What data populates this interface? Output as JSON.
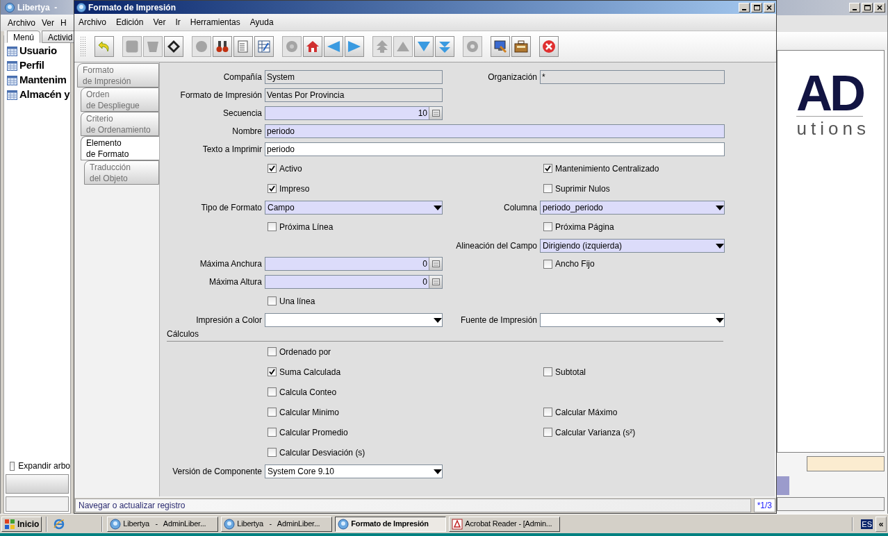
{
  "left_window": {
    "title": "Libertya  -",
    "menu": [
      "Archivo",
      "Ver",
      "H"
    ],
    "tabs": [
      {
        "label": "Menú",
        "selected": true
      },
      {
        "label": "Activid",
        "selected": false
      }
    ],
    "tree": [
      "Usuario",
      "Perfil",
      "Mantenim",
      "Almacén y"
    ],
    "expand_checkbox": {
      "label": "Expandir arbo",
      "checked": false
    }
  },
  "main_window": {
    "title": "Formato de Impresión",
    "menu": [
      "Archivo",
      "Edición",
      "Ver",
      "Ir",
      "Herramientas",
      "Ayuda"
    ],
    "toolbar": [
      [
        {
          "kind": "undo",
          "disabled": false
        }
      ],
      [
        {
          "kind": "new",
          "disabled": true
        },
        {
          "kind": "delete",
          "disabled": true
        },
        {
          "kind": "save",
          "disabled": false
        }
      ],
      [
        {
          "kind": "refresh",
          "disabled": true
        },
        {
          "kind": "find",
          "disabled": false
        },
        {
          "kind": "attachment",
          "disabled": false
        },
        {
          "kind": "grid",
          "disabled": false
        }
      ],
      [
        {
          "kind": "history",
          "disabled": true
        },
        {
          "kind": "home",
          "disabled": false
        },
        {
          "kind": "previous",
          "disabled": false
        },
        {
          "kind": "next",
          "disabled": false
        }
      ],
      [
        {
          "kind": "first",
          "disabled": true
        },
        {
          "kind": "up",
          "disabled": true
        },
        {
          "kind": "down",
          "disabled": false
        },
        {
          "kind": "last",
          "disabled": false
        }
      ],
      [
        {
          "kind": "report",
          "disabled": true
        }
      ],
      [
        {
          "kind": "preview",
          "disabled": false
        },
        {
          "kind": "archive",
          "disabled": false
        }
      ],
      [
        {
          "kind": "close",
          "disabled": false
        }
      ]
    ],
    "tabs": [
      {
        "label": "Formato\nde Impresión",
        "selected": false
      },
      {
        "label": "Orden\nde Despliegue",
        "selected": false
      },
      {
        "label": "Criterio\nde Ordenamiento",
        "selected": false
      },
      {
        "label": "Elemento\nde Formato",
        "selected": true
      },
      {
        "label": "Traducción\ndel Objeto",
        "selected": false
      }
    ],
    "rows": [
      {
        "left": {
          "kind": "text",
          "label": "Compañía",
          "value": "System",
          "readonly": true
        },
        "right": {
          "kind": "text",
          "label": "Organización",
          "value": "*",
          "readonly": true
        }
      },
      {
        "left": {
          "kind": "text",
          "label": "Formato de Impresión",
          "value": "Ventas Por Provincia",
          "readonly": true
        }
      },
      {
        "left": {
          "kind": "number",
          "label": "Secuencia",
          "value": "10",
          "readonly": false,
          "required": true
        }
      },
      {
        "full": {
          "kind": "text",
          "label": "Nombre",
          "value": "periodo",
          "readonly": false,
          "required": true
        }
      },
      {
        "full": {
          "kind": "text",
          "label": "Texto a Imprimir",
          "value": "periodo",
          "readonly": false,
          "required": false
        }
      },
      {
        "left": {
          "kind": "checkbox",
          "label": "Activo",
          "checked": true
        },
        "right": {
          "kind": "checkbox",
          "label": "Mantenimiento Centralizado",
          "checked": true
        }
      },
      {
        "left": {
          "kind": "checkbox",
          "label": "Impreso",
          "checked": true
        },
        "right": {
          "kind": "checkbox",
          "label": "Suprimir Nulos",
          "checked": false
        }
      },
      {
        "left": {
          "kind": "combo",
          "label": "Tipo de Formato",
          "value": "Campo",
          "readonly": false,
          "required": true
        },
        "right": {
          "kind": "combo",
          "label": "Columna",
          "value": "periodo_periodo",
          "readonly": false,
          "required": true
        }
      },
      {
        "left": {
          "kind": "checkbox",
          "label": "Próxima Línea",
          "checked": false
        },
        "right": {
          "kind": "checkbox",
          "label": "Próxima Página",
          "checked": false
        }
      },
      {
        "right": {
          "kind": "combo",
          "label": "Alineación del Campo",
          "value": "Dirigiendo (izquierda)",
          "readonly": false,
          "required": true
        }
      },
      {
        "left": {
          "kind": "number",
          "label": "Máxima Anchura",
          "value": "0",
          "readonly": false,
          "required": true
        },
        "right": {
          "kind": "checkbox",
          "label": "Ancho Fijo",
          "checked": false
        }
      },
      {
        "left": {
          "kind": "number",
          "label": "Máxima Altura",
          "value": "0",
          "readonly": false,
          "required": true
        }
      },
      {
        "left": {
          "kind": "checkbox",
          "label": "Una línea",
          "checked": false
        }
      },
      {
        "left": {
          "kind": "combo",
          "label": "Impresión a Color",
          "readonly": false,
          "required": false
        },
        "right": {
          "kind": "combo",
          "label": "Fuente de Impresión",
          "readonly": false,
          "required": false
        }
      },
      {
        "section": "Cálculos"
      },
      {
        "left": {
          "kind": "checkbox",
          "label": "Ordenado por",
          "checked": false
        }
      },
      {
        "left": {
          "kind": "checkbox",
          "label": "Suma Calculada",
          "checked": true
        },
        "right": {
          "kind": "checkbox",
          "label": "Subtotal",
          "checked": false
        }
      },
      {
        "left": {
          "kind": "checkbox",
          "label": "Calcula Conteo",
          "checked": false
        }
      },
      {
        "left": {
          "kind": "checkbox",
          "label": "Calcular Minimo",
          "checked": false
        },
        "right": {
          "kind": "checkbox",
          "label": "Calcular Máximo",
          "checked": false
        }
      },
      {
        "left": {
          "kind": "checkbox",
          "label": "Calcular Promedio",
          "checked": false
        },
        "right": {
          "kind": "checkbox",
          "label": "Calcular Varianza (s²)",
          "checked": false
        }
      },
      {
        "left": {
          "kind": "checkbox",
          "label": "Calcular Desviación (s)",
          "checked": false
        }
      },
      {
        "left": {
          "kind": "combo",
          "label": "Versión de Componente",
          "value": "System Core 9.10",
          "readonly": false,
          "required": false
        }
      }
    ],
    "status": {
      "message": "Navegar o actualizar registro",
      "record": "*1/3"
    }
  },
  "right_window": {
    "logo": "AD",
    "logo_caption": "utions"
  },
  "taskbar": {
    "start": "Inicio",
    "tasks": [
      {
        "kind": "app",
        "label": "Libertya   -   AdminLiber...",
        "selected": false
      },
      {
        "kind": "app",
        "label": "Libertya   -   AdminLiber...",
        "selected": false
      },
      {
        "kind": "app",
        "label": "Formato de Impresión",
        "selected": true
      },
      {
        "kind": "acrobat",
        "label": "Acrobat Reader - [Admin...",
        "selected": false
      }
    ],
    "language": "ES",
    "tray_toggle": "«"
  }
}
